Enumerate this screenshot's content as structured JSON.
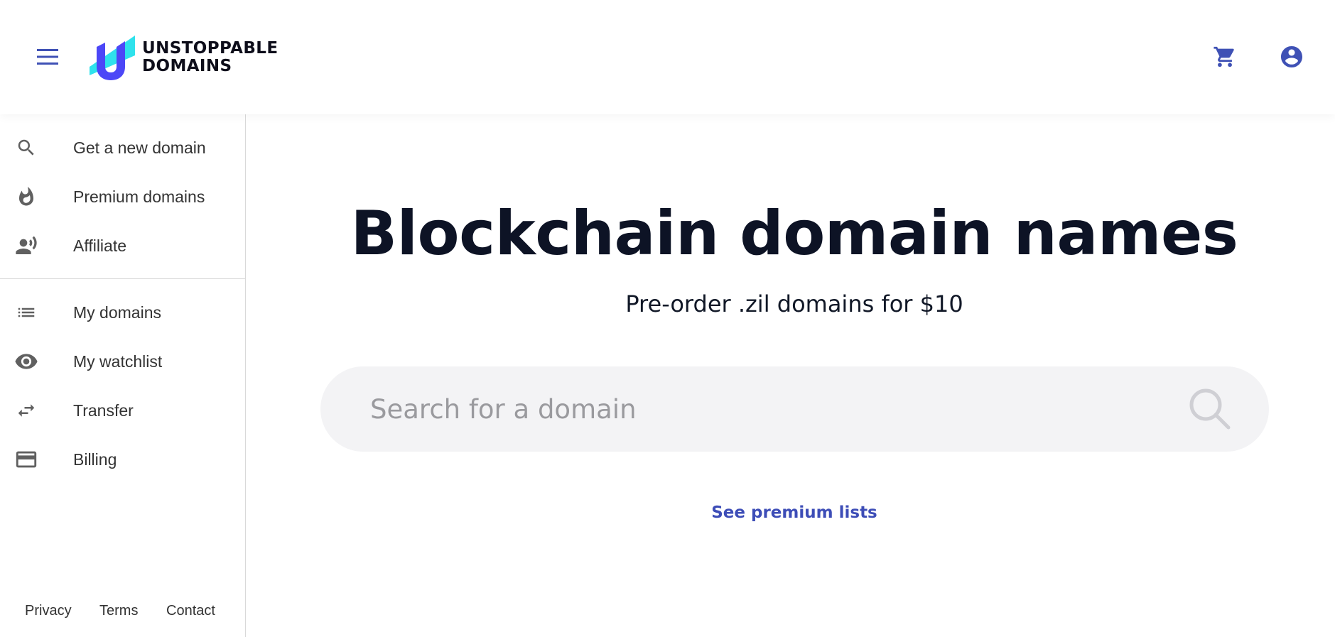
{
  "header": {
    "brand_line1": "UNSTOPPABLE",
    "brand_line2": "DOMAINS",
    "icons": {
      "menu": "menu-icon",
      "cart": "shopping-cart-icon",
      "account": "account-circle-icon"
    },
    "accent_color": "#3f51b5"
  },
  "sidebar": {
    "primary_items": [
      {
        "label": "Get a new domain",
        "icon": "search-icon"
      },
      {
        "label": "Premium domains",
        "icon": "flame-icon"
      },
      {
        "label": "Affiliate",
        "icon": "record-voice-icon"
      }
    ],
    "secondary_items": [
      {
        "label": "My domains",
        "icon": "list-icon"
      },
      {
        "label": "My watchlist",
        "icon": "eye-icon"
      },
      {
        "label": "Transfer",
        "icon": "swap-arrows-icon"
      },
      {
        "label": "Billing",
        "icon": "credit-card-icon"
      }
    ],
    "footer": [
      "Privacy",
      "Terms",
      "Contact"
    ]
  },
  "main": {
    "title": "Blockchain domain names",
    "subtitle": "Pre-order .zil domains for $10",
    "search": {
      "placeholder": "Search for a domain",
      "value": ""
    },
    "premium_link": "See premium lists"
  }
}
